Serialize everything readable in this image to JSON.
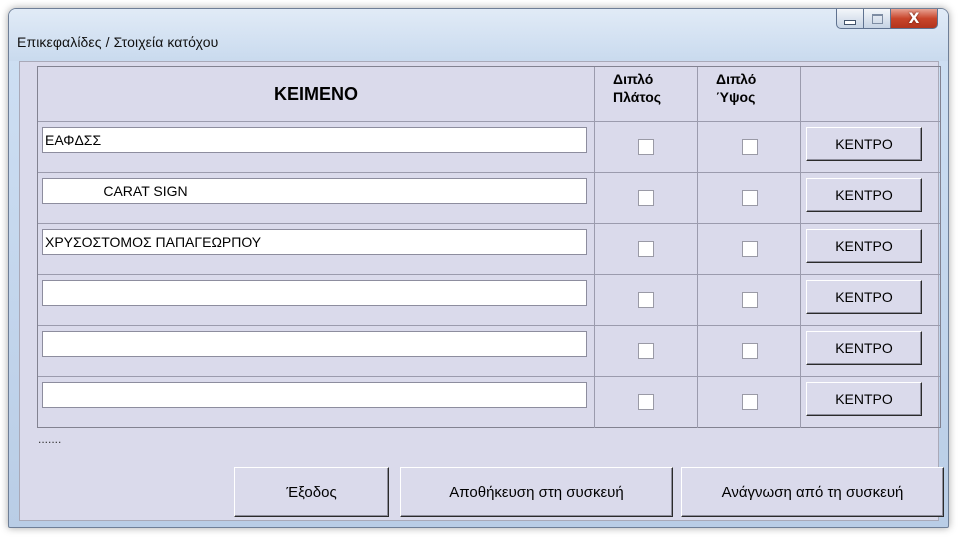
{
  "window": {
    "title": "Επικεφαλίδες / Στοιχεία κατόχου",
    "controls": {
      "minimize": "minimize-icon",
      "maximize": "maximize-icon",
      "close": "close-icon",
      "close_glyph": "X"
    }
  },
  "grid": {
    "headers": {
      "text": "KEIMENO",
      "double_width": [
        "Διπλό",
        "Πλάτος"
      ],
      "double_height": [
        "Διπλό",
        "Ύψος"
      ]
    },
    "rows": [
      {
        "text": "ΕΑΦΔΣΣ",
        "double_width": false,
        "double_height": false,
        "center_label": "KENTPO"
      },
      {
        "text": "               CARAT SIGN",
        "double_width": false,
        "double_height": false,
        "center_label": "KENTPO"
      },
      {
        "text": "ΧΡΥΣΟΣΤΟΜΟΣ ΠΑΠΑΓΕΩΡΠΟΥ",
        "double_width": false,
        "double_height": false,
        "center_label": "KENTPO"
      },
      {
        "text": "",
        "double_width": false,
        "double_height": false,
        "center_label": "KENTPO"
      },
      {
        "text": "",
        "double_width": false,
        "double_height": false,
        "center_label": "KENTPO"
      },
      {
        "text": "",
        "double_width": false,
        "double_height": false,
        "center_label": "KENTPO"
      }
    ]
  },
  "status_text": ".......",
  "buttons": {
    "exit": "Έξοδος",
    "save": "Αποθήκευση στη συσκευή",
    "read": "Ανάγνωση από τη συσκευή"
  },
  "colors": {
    "client_bg": "#dadaeb",
    "close_button": "#c8452b"
  }
}
